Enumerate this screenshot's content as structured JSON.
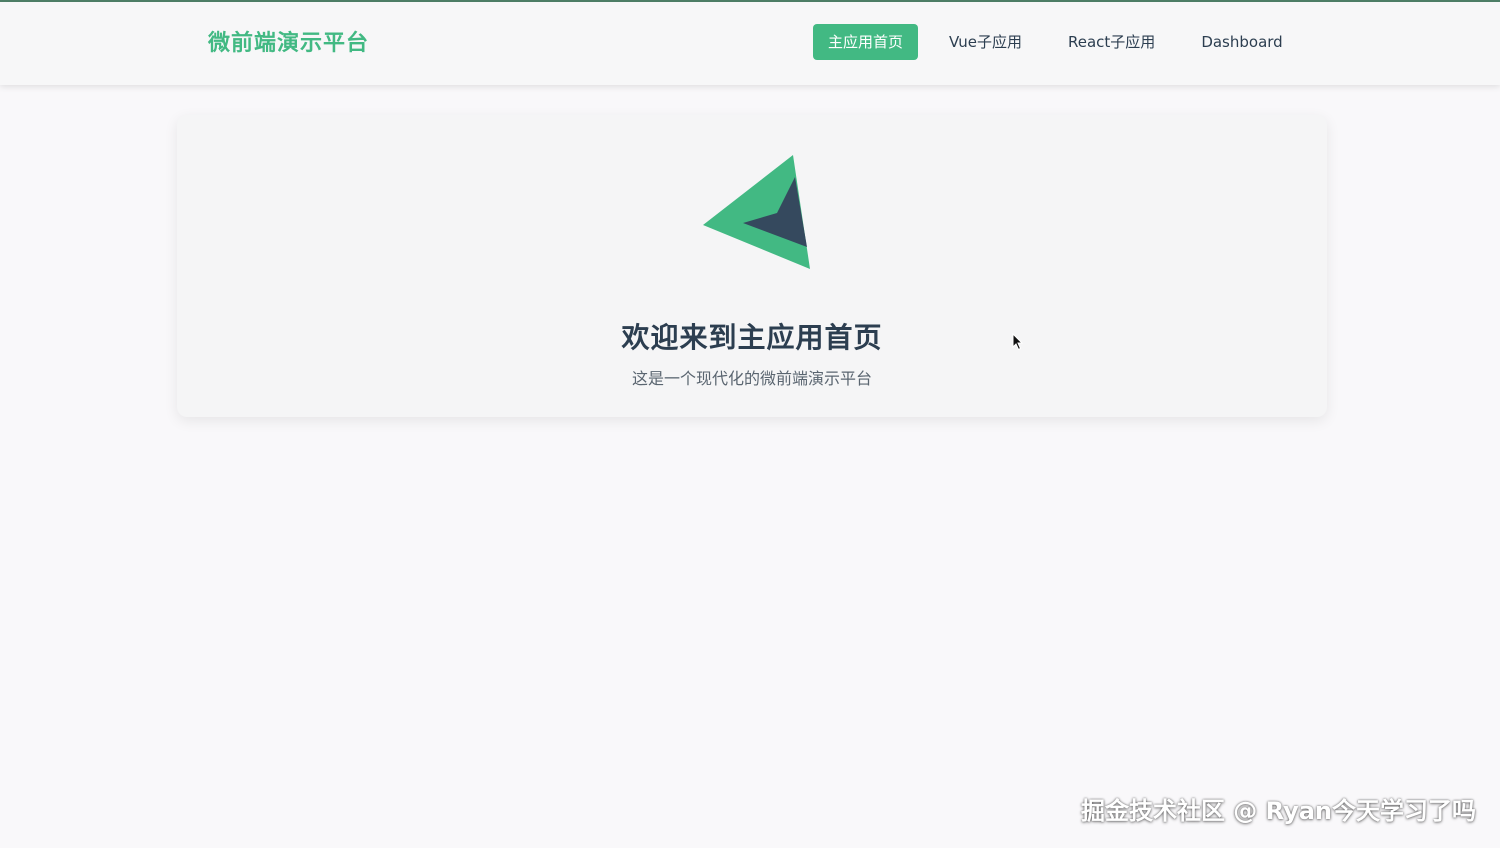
{
  "header": {
    "brand": "微前端演示平台",
    "nav": [
      {
        "label": "主应用首页",
        "active": true
      },
      {
        "label": "Vue子应用",
        "active": false
      },
      {
        "label": "React子应用",
        "active": false
      },
      {
        "label": "Dashboard",
        "active": false
      }
    ]
  },
  "main": {
    "logo_icon": "vue-logo-icon",
    "title": "欢迎来到主应用首页",
    "subtitle": "这是一个现代化的微前端演示平台"
  },
  "watermark": "掘金技术社区 @ Ryan今天学习了吗",
  "colors": {
    "accent": "#42b983",
    "dark": "#2c3e50",
    "background": "#f9f8fa"
  }
}
